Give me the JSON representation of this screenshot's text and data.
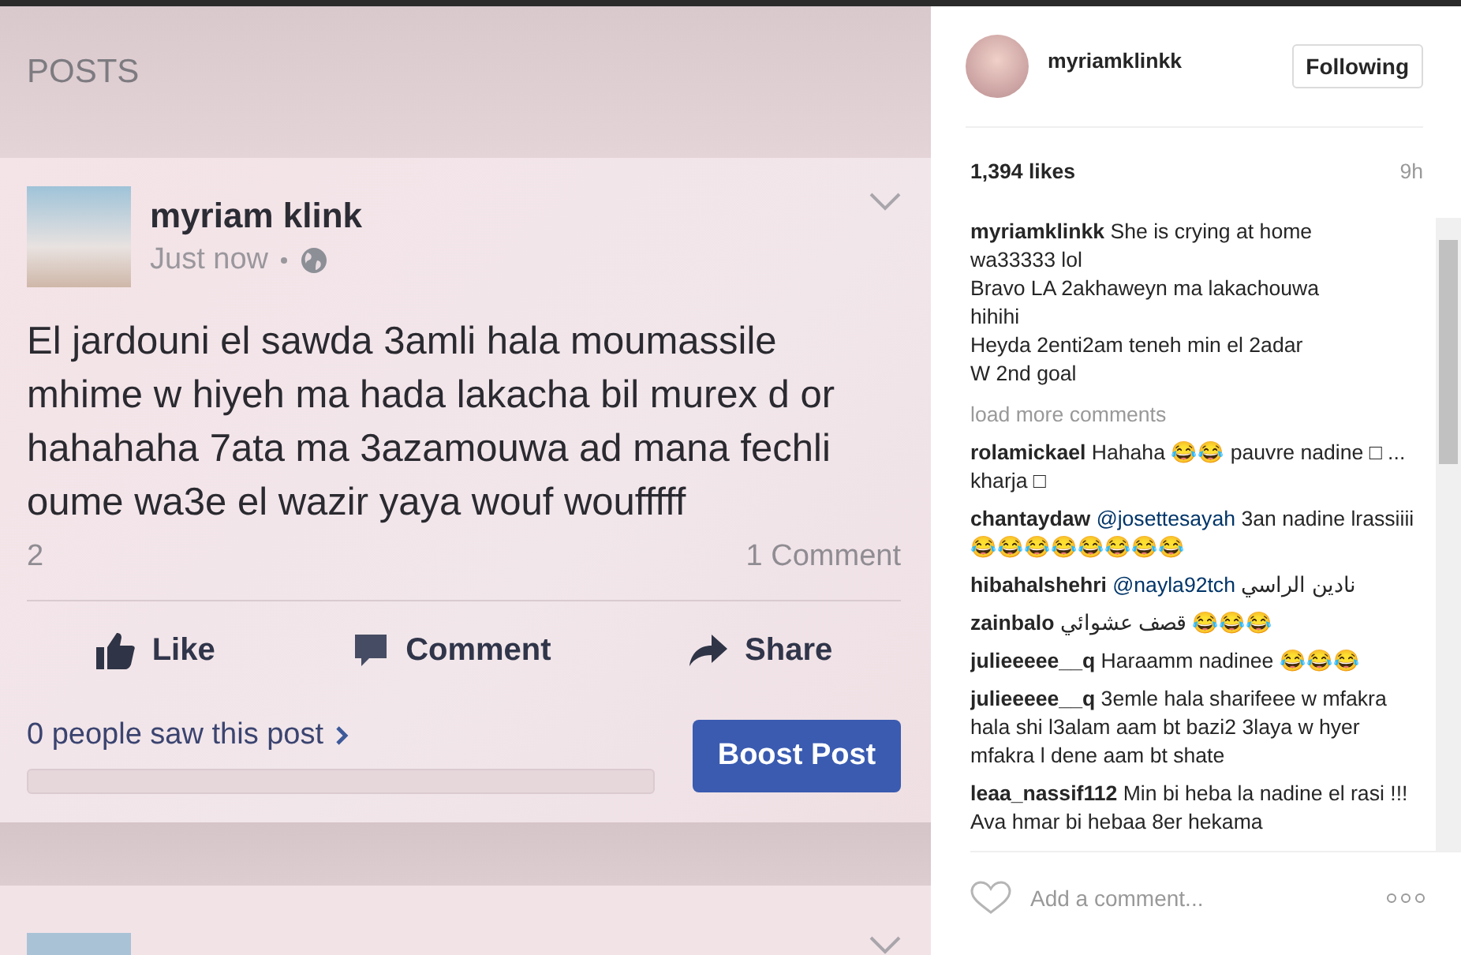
{
  "screenshot": {
    "section_title": "POSTS",
    "post": {
      "author": "myriam klink",
      "time": "Just now",
      "text": "El jardouni el sawda 3amli hala moumassile mhime w hiyeh ma hada lakacha bil murex d or hahahaha 7ata ma 3azamouwa ad mana fechli oume wa3e el wazir yaya  wouf woufffff",
      "reactions": "2",
      "comments": "1 Comment",
      "actions": [
        {
          "kind": "like",
          "label": "Like"
        },
        {
          "kind": "comment",
          "label": "Comment"
        },
        {
          "kind": "share",
          "label": "Share"
        }
      ],
      "reach": "0 people saw this post",
      "reach_level": {
        "level": 0
      },
      "boost": "Boost Post"
    }
  },
  "panel": {
    "username": "myriamklinkk",
    "follow_button": "Following",
    "likes": "1,394 likes",
    "age": "9h",
    "caption": {
      "user": "myriamklinkk",
      "lines": [
        "She is crying at home",
        "wa33333 lol",
        "Bravo LA 2akhaweyn ma lakachouwa",
        "hihihi",
        "Heyda 2enti2am teneh min el 2adar",
        "W 2nd goal"
      ]
    },
    "load_more": "load more comments",
    "comments": [
      {
        "user": "rolamickael",
        "text": "Hahaha 😂😂 pauvre nadine □ ... kharja □"
      },
      {
        "user": "chantaydaw",
        "mention": "@josettesayah",
        "text": "3an nadine lrassiiii😂😂😂😂😂😂😂😂"
      },
      {
        "user": "hibahalshehri",
        "mention": "@nayla92tch",
        "text": "نادين الراسي"
      },
      {
        "user": "zainbalo",
        "text": "قصف عشوائي 😂😂😂"
      },
      {
        "user": "julieeeee__q",
        "text": "Haraamm nadinee 😂😂😂"
      },
      {
        "user": "julieeeee__q",
        "text": "3emle hala sharifeee w mfakra hala shi l3alam aam bt bazi2 3laya w hyer mfakra l dene aam bt shate"
      },
      {
        "user": "leaa_nassif112",
        "text": "Min bi heba la nadine el rasi !!! Ava hmar bi hebaa 8er hekama"
      }
    ],
    "add_comment": {
      "placeholder": "Add a comment..."
    }
  }
}
